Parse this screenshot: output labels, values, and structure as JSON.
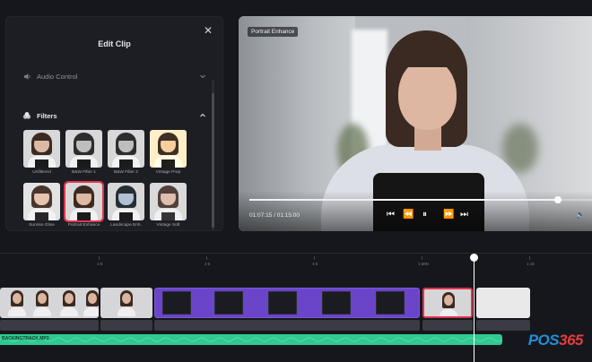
{
  "edit_panel": {
    "title": "Edit Clip",
    "close_glyph": "✕",
    "audio_control_label": "Audio Control",
    "filters_label": "Filters",
    "filters": [
      {
        "name": "Unfiltered",
        "style": "normal"
      },
      {
        "name": "B&W Filter 1",
        "style": "bw"
      },
      {
        "name": "B&W Filter 2",
        "style": "bw"
      },
      {
        "name": "Vintage Prep",
        "style": "warm"
      },
      {
        "name": "Sunrise Glow",
        "style": "glow"
      },
      {
        "name": "Portrait Enhance",
        "style": "normal",
        "selected": true
      },
      {
        "name": "Landscape Enh.",
        "style": "cool"
      },
      {
        "name": "Vintage Soft",
        "style": "soft"
      }
    ]
  },
  "preview": {
    "badge": "Portrait Enhance",
    "timecode": "01:07:15 / 01:15:00",
    "progress": 0.9,
    "controls": {
      "skip_back": "⏮",
      "rewind": "⏪",
      "pause": "⏸",
      "forward": "⏩",
      "skip_forward": "⏭",
      "volume": "🔈"
    }
  },
  "timeline": {
    "ruler_labels": [
      "1:5",
      "2:5",
      "4:5",
      "1:MIN",
      "1:15"
    ],
    "audio_track_label": "BACKINGTRACK.MP3"
  },
  "logo": {
    "text": "POS",
    "number": "365"
  },
  "colors": {
    "accent_red": "#e0354e",
    "clip_purple": "#6a45c9",
    "audio_green": "#2fc991",
    "background": "#16171c"
  }
}
